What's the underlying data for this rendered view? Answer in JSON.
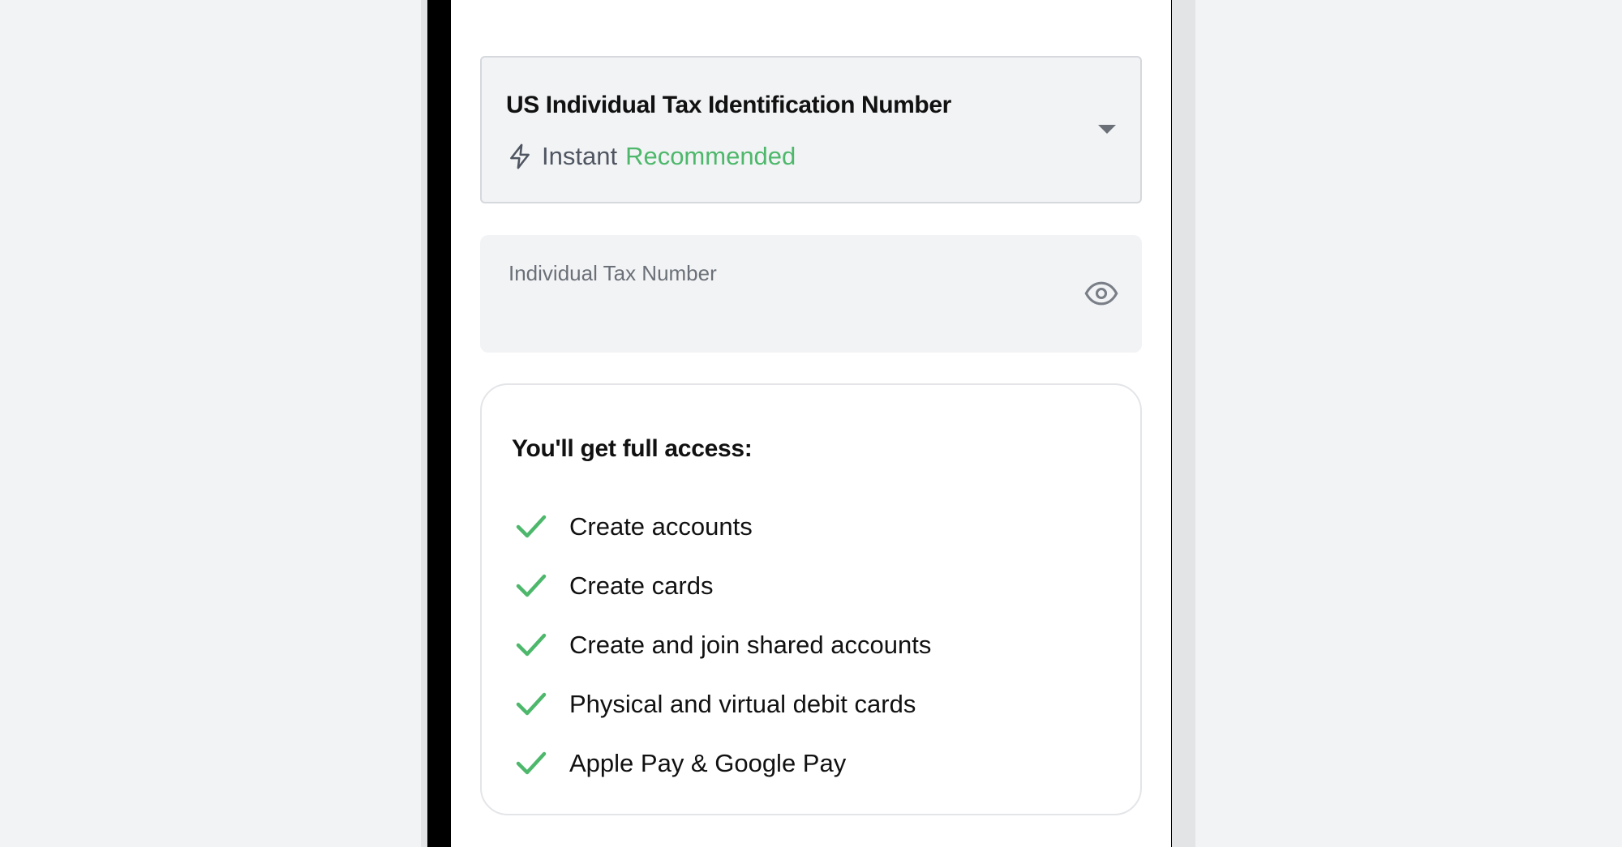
{
  "colors": {
    "accent_green": "#4DB86B",
    "text_primary": "#111111",
    "text_secondary": "#6B7078",
    "field_bg": "#F2F3F5"
  },
  "id_select": {
    "title": "US Individual Tax Identification Number",
    "speed_label": "Instant",
    "badge": "Recommended",
    "speed_icon": "lightning-bolt-icon",
    "toggle_icon": "caret-down-icon"
  },
  "tax_field": {
    "label": "Individual Tax Number",
    "value": "",
    "visibility_icon": "eye-icon"
  },
  "access": {
    "title": "You'll get full access:",
    "item_icon": "check-icon",
    "items": [
      {
        "label": "Create accounts"
      },
      {
        "label": "Create cards"
      },
      {
        "label": "Create and join shared accounts"
      },
      {
        "label": "Physical and virtual debit cards"
      },
      {
        "label": "Apple Pay & Google Pay"
      }
    ]
  }
}
